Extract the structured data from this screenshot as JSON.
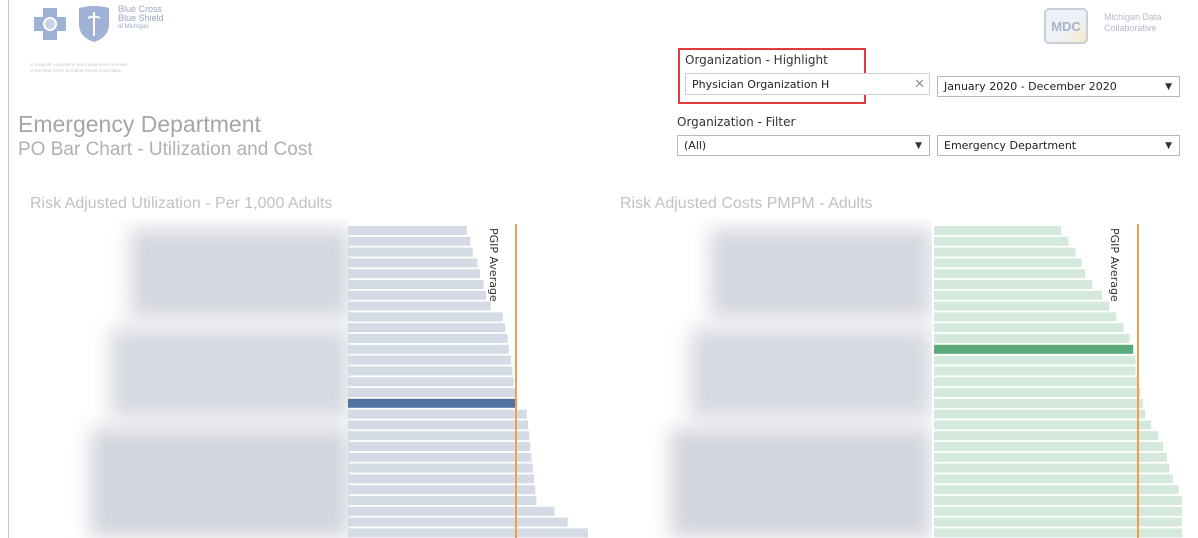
{
  "brand": {
    "logo_lines": [
      "Blue Cross",
      "Blue Shield",
      "of Michigan"
    ],
    "disclaimer_lines": [
      "A nonprofit corporation and independent licensee",
      "of the Blue Cross and Blue Shield Association"
    ]
  },
  "mdc": {
    "badge": "MDC",
    "lines": [
      "Michigan Data",
      "Collaborative"
    ]
  },
  "page": {
    "title": "Emergency Department",
    "subtitle": "PO Bar Chart - Utilization and Cost"
  },
  "filters": {
    "highlight_label": "Organization - Highlight",
    "highlight_value": "Physician Organization H",
    "clear_icon": "×",
    "date_value": "January 2020 - December 2020",
    "filter_label": "Organization - Filter",
    "filter_value": "(All)",
    "category_value": "Emergency Department",
    "caret": "▼"
  },
  "colors": {
    "util_bar": "#d5dbe5",
    "util_highlight": "#4f72a0",
    "cost_bar": "#d5e8dc",
    "cost_highlight": "#5aaa7a",
    "average_line": "#f0a04a"
  },
  "chart_data": [
    {
      "type": "bar",
      "title": "Risk Adjusted Utilization - Per 1,000 Adults",
      "reference_line": {
        "label": "PGIP Average",
        "value": 140
      },
      "values": [
        99,
        102,
        104,
        108,
        110,
        113,
        115,
        119,
        129,
        131,
        133,
        134,
        136,
        137,
        138,
        140,
        141,
        149,
        150,
        151,
        152,
        153,
        154,
        155,
        156,
        157,
        172,
        183,
        200
      ],
      "highlight_index": 16
    },
    {
      "type": "bar",
      "title": "Risk Adjusted Costs PMPM - Adults",
      "reference_line": {
        "label": "PGIP Average",
        "value": 170
      },
      "values": [
        106,
        112,
        118,
        123,
        126,
        132,
        140,
        146,
        152,
        158,
        163,
        166,
        168,
        168,
        170,
        172,
        174,
        176,
        181,
        187,
        191,
        194,
        196,
        199,
        204,
        208,
        213,
        220,
        228
      ],
      "highlight_index": 11
    }
  ]
}
